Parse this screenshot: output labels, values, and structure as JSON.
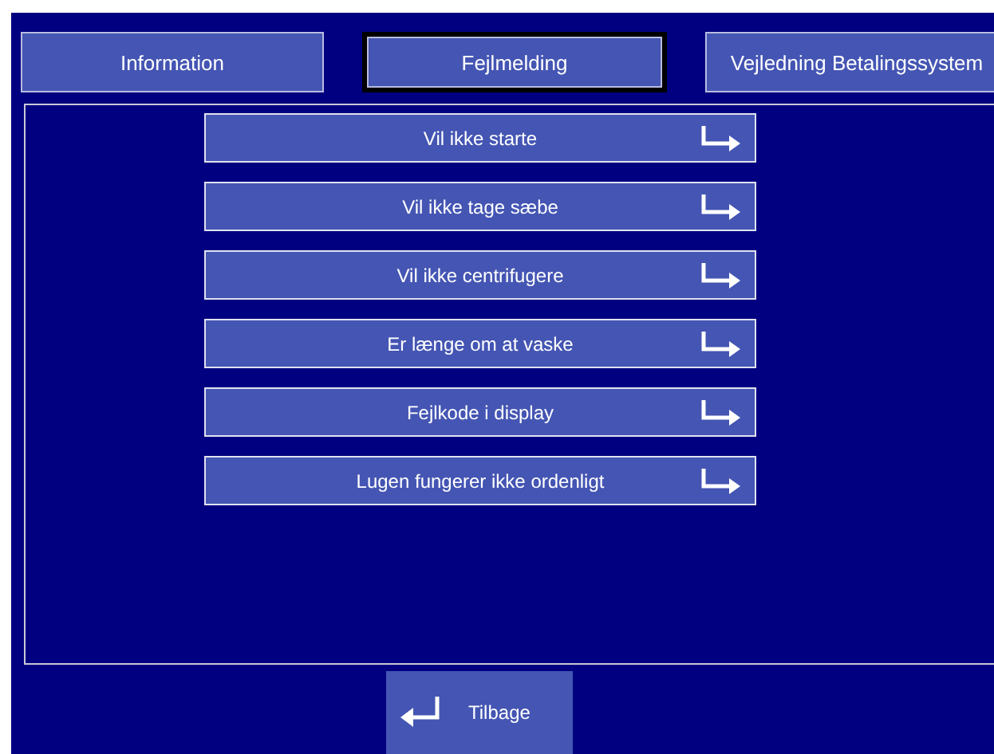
{
  "tabs": [
    {
      "label": "Information",
      "selected": false
    },
    {
      "label": "Fejlmelding",
      "selected": true
    },
    {
      "label": "Vejledning Betalingssystem",
      "selected": false
    }
  ],
  "menu_items": [
    {
      "label": "Vil ikke starte"
    },
    {
      "label": "Vil ikke tage sæbe"
    },
    {
      "label": "Vil ikke centrifugere"
    },
    {
      "label": "Er længe om at vaske"
    },
    {
      "label": "Fejlkode i display"
    },
    {
      "label": "Lugen fungerer ikke ordenligt"
    }
  ],
  "back_button": {
    "label": "Tilbage"
  }
}
